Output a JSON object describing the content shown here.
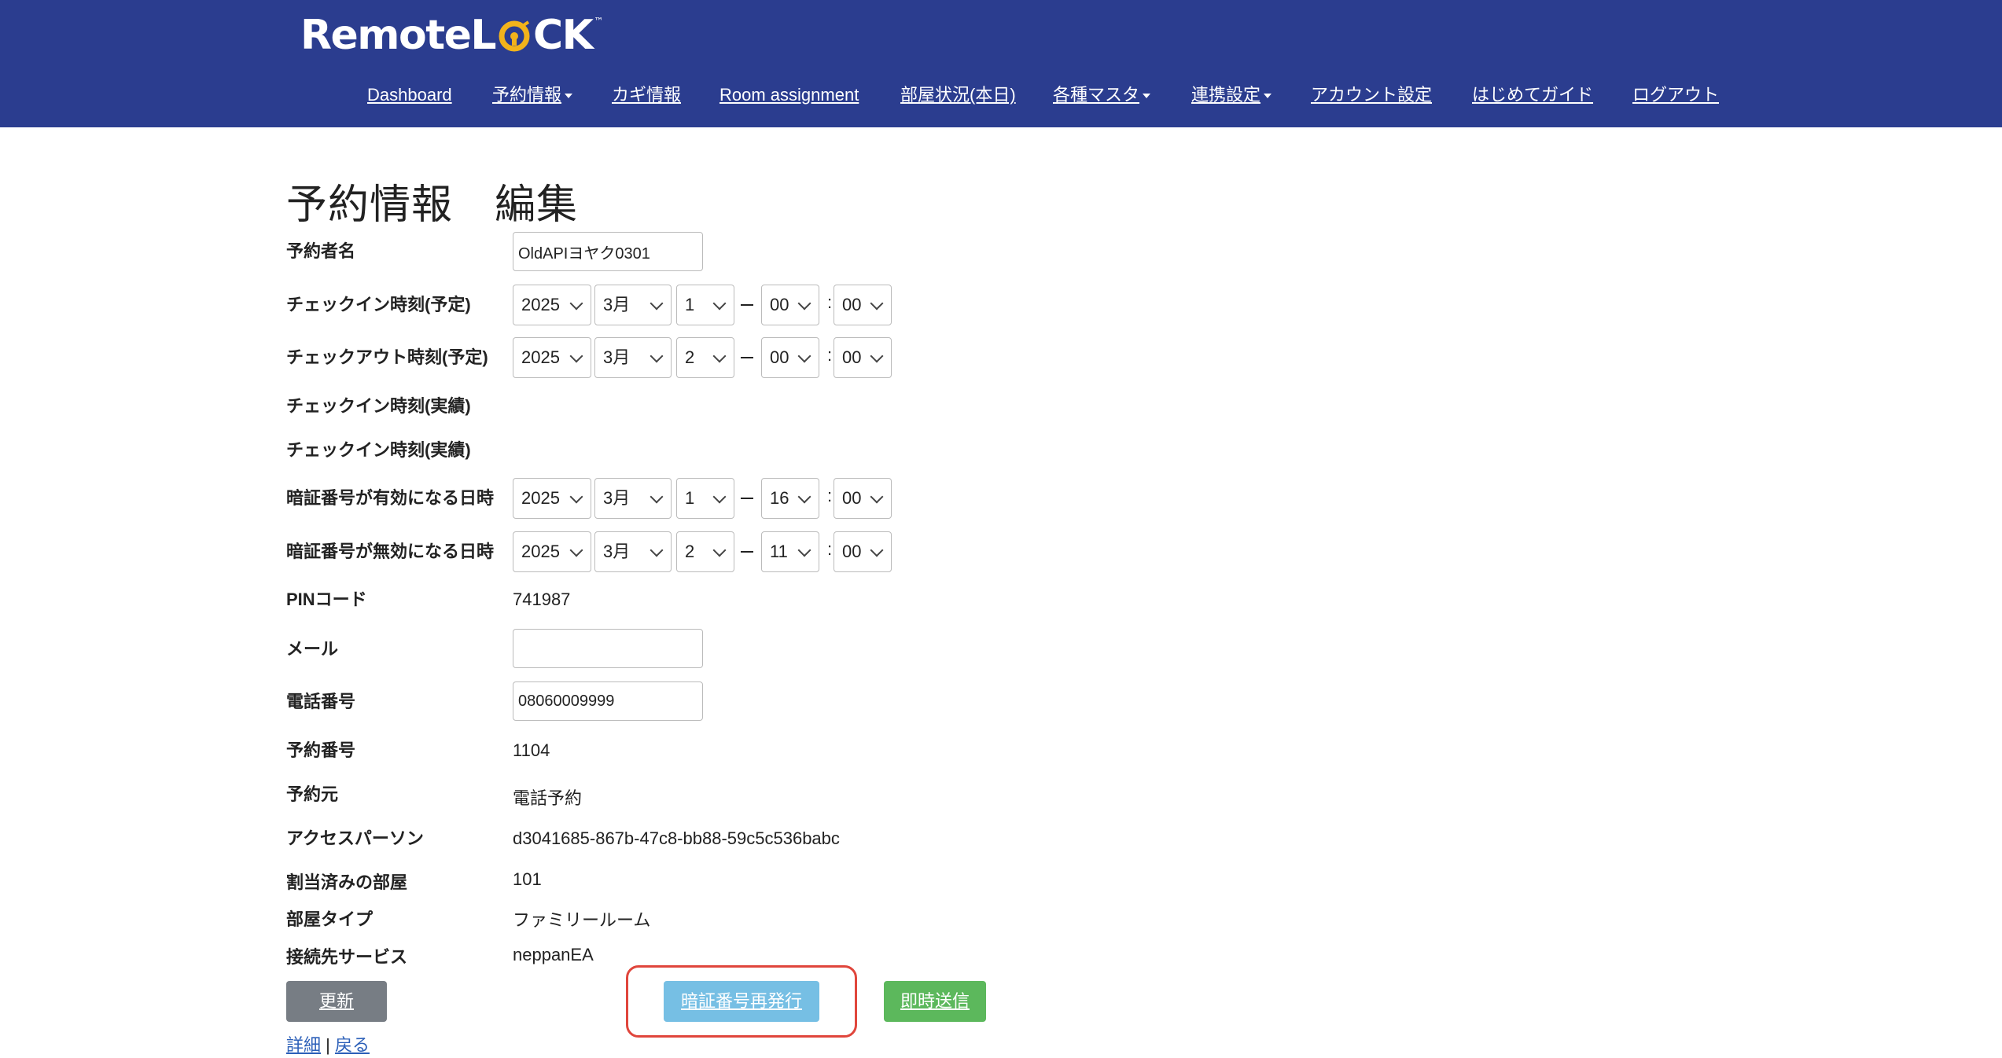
{
  "header": {
    "logo_text_part1": "Remote",
    "logo_text_part2": "L",
    "logo_text_part3": "CK",
    "logo_tm": "™",
    "background_color": "#2b3d8f",
    "accent_color": "#f2b31b",
    "nav": [
      {
        "label": "Dashboard",
        "dropdown": false
      },
      {
        "label": "予約情報",
        "dropdown": true
      },
      {
        "label": "カギ情報",
        "dropdown": false
      },
      {
        "label": "Room assignment",
        "dropdown": false
      },
      {
        "label": "部屋状況(本日)",
        "dropdown": false
      },
      {
        "label": "各種マスタ",
        "dropdown": true
      },
      {
        "label": "連携設定",
        "dropdown": true
      },
      {
        "label": "アカウント設定",
        "dropdown": false
      },
      {
        "label": "はじめてガイド",
        "dropdown": false
      },
      {
        "label": "ログアウト",
        "dropdown": false
      }
    ]
  },
  "page": {
    "title": "予約情報　編集"
  },
  "form": {
    "guest_name": {
      "label": "予約者名",
      "value": "OldAPIヨヤク0301"
    },
    "checkin_planned": {
      "label": "チェックイン時刻(予定)",
      "year": "2025",
      "month": "3月",
      "day": "1",
      "hour": "00",
      "minute": "00"
    },
    "checkout_planned": {
      "label": "チェックアウト時刻(予定)",
      "year": "2025",
      "month": "3月",
      "day": "2",
      "hour": "00",
      "minute": "00"
    },
    "checkin_actual": {
      "label": "チェックイン時刻(実績)"
    },
    "checkin_actual_2": {
      "label": "チェックイン時刻(実績)"
    },
    "pin_valid_from": {
      "label": "暗証番号が有効になる日時",
      "year": "2025",
      "month": "3月",
      "day": "1",
      "hour": "16",
      "minute": "00"
    },
    "pin_valid_until": {
      "label": "暗証番号が無効になる日時",
      "year": "2025",
      "month": "3月",
      "day": "2",
      "hour": "11",
      "minute": "00"
    },
    "pin_code": {
      "label": "PINコード",
      "value": "741987"
    },
    "email": {
      "label": "メール",
      "value": ""
    },
    "phone": {
      "label": "電話番号",
      "value": "08060009999"
    },
    "reservation_number": {
      "label": "予約番号",
      "value": "1104"
    },
    "reservation_source": {
      "label": "予約元",
      "value": "電話予約"
    },
    "access_person": {
      "label": "アクセスパーソン",
      "value": "d3041685-867b-47c8-bb88-59c5c536babc"
    },
    "assigned_room": {
      "label": "割当済みの部屋",
      "value": "101"
    },
    "room_type": {
      "label": "部屋タイプ",
      "value": "ファミリールーム"
    },
    "connected_service": {
      "label": "接続先サービス",
      "value": "neppanEA"
    }
  },
  "buttons": {
    "update": "更新",
    "reissue_pin": "暗証番号再発行",
    "send_now": "即時送信"
  },
  "footer": {
    "detail_link": "詳細",
    "separator": "|",
    "back_link": "戻る"
  },
  "colors": {
    "update_button": "#777d84",
    "reissue_button": "#76bfe4",
    "send_button": "#5cb85c",
    "highlight": "#e0463c"
  }
}
